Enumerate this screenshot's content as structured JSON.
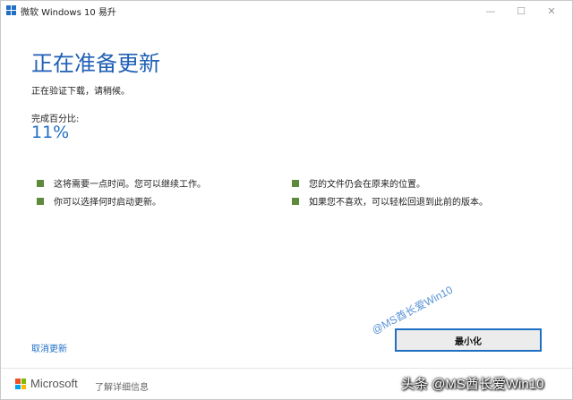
{
  "window": {
    "title": "微软 Windows 10 易升",
    "controls": {
      "minimize": "—",
      "maximize": "☐",
      "close": "✕"
    }
  },
  "main": {
    "heading": "正在准备更新",
    "subtitle": "正在验证下载，请稍候。",
    "percent_label": "完成百分比:",
    "percent_value": "11%",
    "progress": 0.11
  },
  "info_items": [
    "这将需要一点时间。您可以继续工作。",
    "你可以选择何时启动更新。",
    "您的文件仍会在原来的位置。",
    "如果您不喜欢，可以轻松回退到此前的版本。"
  ],
  "actions": {
    "cancel_label": "取消更新",
    "minimize_label": "最小化"
  },
  "footer": {
    "brand": "Microsoft",
    "details_label": "了解详细信息"
  },
  "watermarks": {
    "diagonal": "@MS酋长爱Win10",
    "corner": "头条 @MS酋长爱Win10"
  },
  "colors": {
    "accent": "#1f6fc5",
    "heading": "#1f5fb5",
    "bullet": "#5e8a3c",
    "ms_red": "#f25022",
    "ms_green": "#7fba00",
    "ms_blue": "#00a4ef",
    "ms_yellow": "#ffb900"
  }
}
